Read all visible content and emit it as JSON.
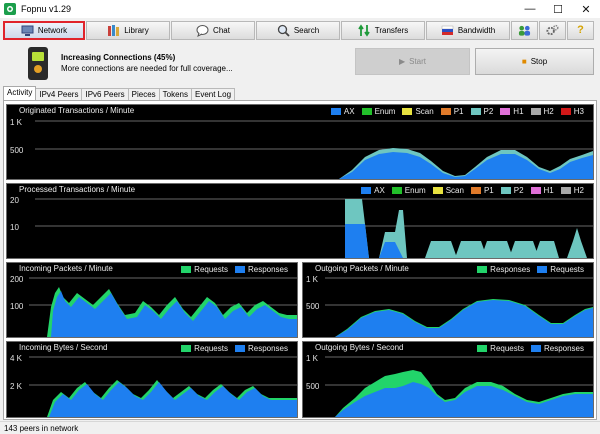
{
  "window": {
    "title": "Fopnu v1.29"
  },
  "toolbar": {
    "network": "Network",
    "library": "Library",
    "chat": "Chat",
    "search": "Search",
    "transfers": "Transfers",
    "bandwidth": "Bandwidth"
  },
  "status": {
    "heading": "Increasing Connections",
    "percent": "(45%)",
    "message": "More connections are needed for full coverage...",
    "start_label": "Start",
    "stop_label": "Stop"
  },
  "tabs": [
    "Activity",
    "IPv4 Peers",
    "IPv6 Peers",
    "Pieces",
    "Tokens",
    "Event Log"
  ],
  "charts": {
    "originated": {
      "title": "Originated Transactions / Minute",
      "y_ticks": [
        "1 K",
        "500"
      ],
      "legend": [
        {
          "name": "AX",
          "color": "#1e7ff0"
        },
        {
          "name": "Enum",
          "color": "#22c02a"
        },
        {
          "name": "Scan",
          "color": "#e8e240"
        },
        {
          "name": "P1",
          "color": "#e07a2a"
        },
        {
          "name": "P2",
          "color": "#6ec6c0"
        },
        {
          "name": "H1",
          "color": "#e070d8"
        },
        {
          "name": "H2",
          "color": "#a8a8a8"
        },
        {
          "name": "H3",
          "color": "#d21818"
        }
      ]
    },
    "processed": {
      "title": "Processed Transactions / Minute",
      "y_ticks": [
        "20",
        "10"
      ],
      "legend": [
        {
          "name": "AX",
          "color": "#1e7ff0"
        },
        {
          "name": "Enum",
          "color": "#22c02a"
        },
        {
          "name": "Scan",
          "color": "#e8e240"
        },
        {
          "name": "P1",
          "color": "#e07a2a"
        },
        {
          "name": "P2",
          "color": "#6ec6c0"
        },
        {
          "name": "H1",
          "color": "#e070d8"
        },
        {
          "name": "H2",
          "color": "#a8a8a8"
        }
      ]
    },
    "incoming_packets": {
      "title": "Incoming Packets / Minute",
      "y_ticks": [
        "200",
        "100"
      ],
      "legend": [
        {
          "name": "Requests",
          "color": "#22d46a"
        },
        {
          "name": "Responses",
          "color": "#1e7ff0"
        }
      ]
    },
    "outgoing_packets": {
      "title": "Outgoing Packets / Minute",
      "y_ticks": [
        "1 K",
        "500"
      ],
      "legend": [
        {
          "name": "Responses",
          "color": "#22d46a"
        },
        {
          "name": "Requests",
          "color": "#1e7ff0"
        }
      ]
    },
    "incoming_bytes": {
      "title": "Incoming Bytes / Second",
      "y_ticks": [
        "4 K",
        "2 K"
      ],
      "legend": [
        {
          "name": "Requests",
          "color": "#22d46a"
        },
        {
          "name": "Responses",
          "color": "#1e7ff0"
        }
      ]
    },
    "outgoing_bytes": {
      "title": "Outgoing Bytes / Second",
      "y_ticks": [
        "1 K",
        "500"
      ],
      "legend": [
        {
          "name": "Requests",
          "color": "#22d46a"
        },
        {
          "name": "Responses",
          "color": "#1e7ff0"
        }
      ]
    }
  },
  "statusbar": {
    "peers": "143 peers in network"
  }
}
